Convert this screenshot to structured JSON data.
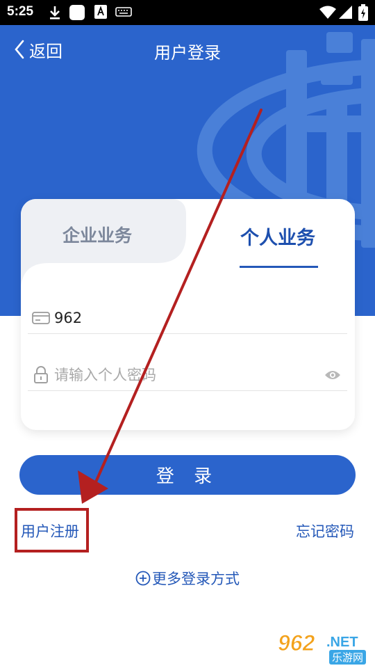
{
  "status_bar": {
    "time": "5:25",
    "left_icons": [
      "download-icon",
      "app-square-icon",
      "a-badge-icon",
      "keyboard-icon"
    ],
    "right_icons": [
      "wifi-icon",
      "signal-icon",
      "battery-icon"
    ]
  },
  "header": {
    "back_label": "返回",
    "title": "用户登录",
    "background_color": "#2b64cc"
  },
  "tabs": [
    {
      "label": "企业业务",
      "active": false
    },
    {
      "label": "个人业务",
      "active": true
    }
  ],
  "form": {
    "account_value": "962",
    "password_placeholder": "请输入个人密码"
  },
  "actions": {
    "login_label": "登 录",
    "register_label": "用户注册",
    "forgot_label": "忘记密码",
    "more_login_label": "更多登录方式"
  },
  "annotation": {
    "color": "#b42020",
    "highlighted": "用户注册"
  },
  "watermark": {
    "number": "962",
    "suffix": ".NET",
    "cn": "乐游网"
  },
  "colors": {
    "primary": "#2b64cc",
    "link": "#2458b8",
    "inactive_tab": "#7c879b"
  }
}
